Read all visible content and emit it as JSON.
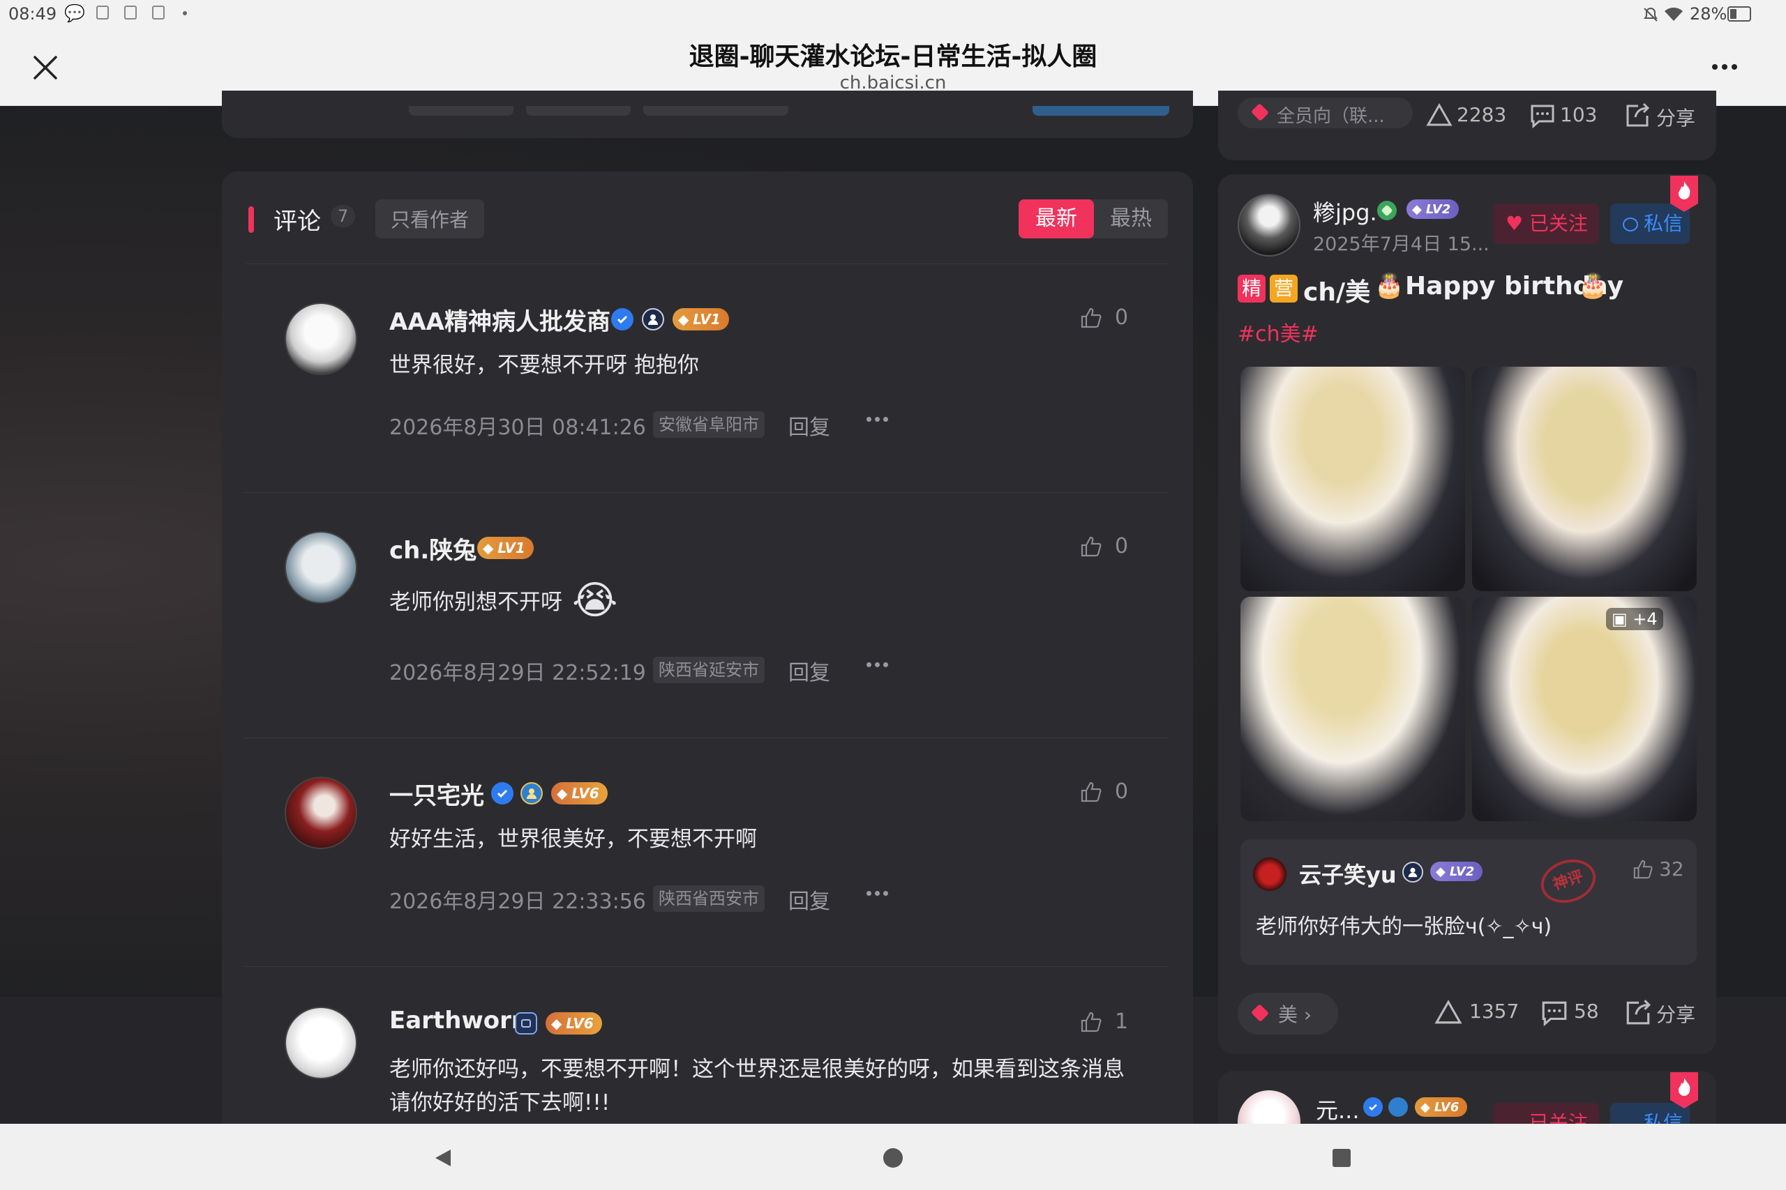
{
  "status": {
    "time": "08:49",
    "battery": "28%"
  },
  "header": {
    "title": "退圈-聊天灌水论坛-日常生活-拟人圈",
    "url": "ch.baicsi.cn"
  },
  "comments": {
    "label": "评论",
    "count": "7",
    "author_only": "只看作者",
    "sort_new": "最新",
    "sort_hot": "最热",
    "items": [
      {
        "name": "AAA精神病人批发商",
        "level": "LV1",
        "text": "世界很好，不要想不开呀 抱抱你",
        "time": "2026年8月30日 08:41:26",
        "location": "安徽省阜阳市",
        "reply": "回复",
        "likes": "0"
      },
      {
        "name": "ch.陕兔",
        "level": "LV1",
        "text": "老师你别想不开呀",
        "time": "2026年8月29日 22:52:19",
        "location": "陕西省延安市",
        "reply": "回复",
        "likes": "0"
      },
      {
        "name": "一只宅光",
        "level": "LV6",
        "text": "好好生活，世界很美好，不要想不开啊",
        "time": "2026年8月29日 22:33:56",
        "location": "陕西省西安市",
        "reply": "回复",
        "likes": "0"
      },
      {
        "name": "Earthworm",
        "level": "LV6",
        "text": "老师你还好吗，不要想不开啊！这个世界还是很美好的呀，如果看到这条消息请你好好的活下去啊!!!",
        "likes": "1"
      }
    ]
  },
  "right": {
    "top_bar": {
      "category": "全员向（联...",
      "views": "2283",
      "comments": "103",
      "share": "分享"
    },
    "post": {
      "username": "糁jpg.",
      "level": "LV2",
      "date": "2025年7月4日 15...",
      "follow": "已关注",
      "message": "私信",
      "tag_jing": "精",
      "tag_ying": "营",
      "title_main": "ch/美",
      "title_bd": "Happy birthday",
      "hashtag": "#ch美#",
      "more_images": "+4",
      "hot_comment": {
        "name": "云子笑yu",
        "level": "LV2",
        "likes": "32",
        "text": "老师你好伟大的一张脸ч(✧_✧ч)",
        "stamp": "神评"
      },
      "footer": {
        "category": "美",
        "views": "1357",
        "comments": "58",
        "share": "分享"
      }
    },
    "next_post": {
      "username": "元...",
      "level": "LV6",
      "follow": "已关注",
      "message": "私信"
    }
  },
  "colors": {
    "accent": "#f0325c",
    "bg": "#202124",
    "card": "#2c2c30"
  }
}
